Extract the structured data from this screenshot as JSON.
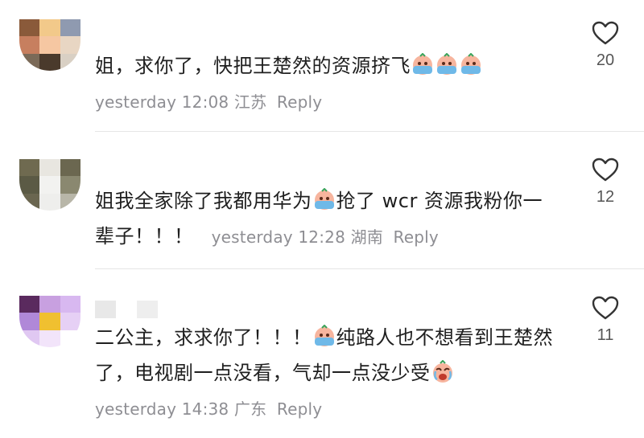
{
  "comments": [
    {
      "text_parts": [
        "姐，求你了，快把王楚然的资源挤飞"
      ],
      "meta": {
        "time": "yesterday 12:08",
        "location": "江苏",
        "reply": "Reply"
      },
      "likes": "20",
      "avatar_colors": [
        "#8a5a3a",
        "#f2c98a",
        "#9aa3b5",
        "#c77f5f",
        "#f6c7a2",
        "#e8d6c3",
        "#7b6a58",
        "#4a3a2c",
        "#d9d0c4"
      ],
      "username_colors": [
        "#ffffff",
        "#ffffff",
        "#ffffff"
      ]
    },
    {
      "text_parts": [
        "姐我全家除了我都用华为",
        "抢了 wcr 资源我粉你一辈子！！！"
      ],
      "meta": {
        "time": "yesterday 12:28",
        "location": "湖南",
        "reply": "Reply"
      },
      "likes": "12",
      "avatar_colors": [
        "#6f6a50",
        "#e8e6e0",
        "#6b6750",
        "#5b5a45",
        "#f2f2f0",
        "#8a8870",
        "#6a6650",
        "#eeeeec",
        "#b8b6a8"
      ],
      "username_colors": [
        "#ffffff",
        "#ffffff",
        "#ffffff"
      ]
    },
    {
      "text_parts": [
        "二公主，求求你了！！！",
        "纯路人也不想看到王楚然了，电视剧一点没看，气却一点没少受"
      ],
      "meta": {
        "time": "yesterday 14:38",
        "location": "广东",
        "reply": "Reply"
      },
      "likes": "11",
      "avatar_colors": [
        "#5a2a5e",
        "#c8a0e0",
        "#d8b8f0",
        "#b088d8",
        "#f0c030",
        "#e6d0f5",
        "#e0c8f2",
        "#f2e4fa",
        "#ffffff"
      ],
      "username_colors": [
        "#e6e6e6",
        "#ffffff",
        "#eeeeee"
      ]
    }
  ]
}
